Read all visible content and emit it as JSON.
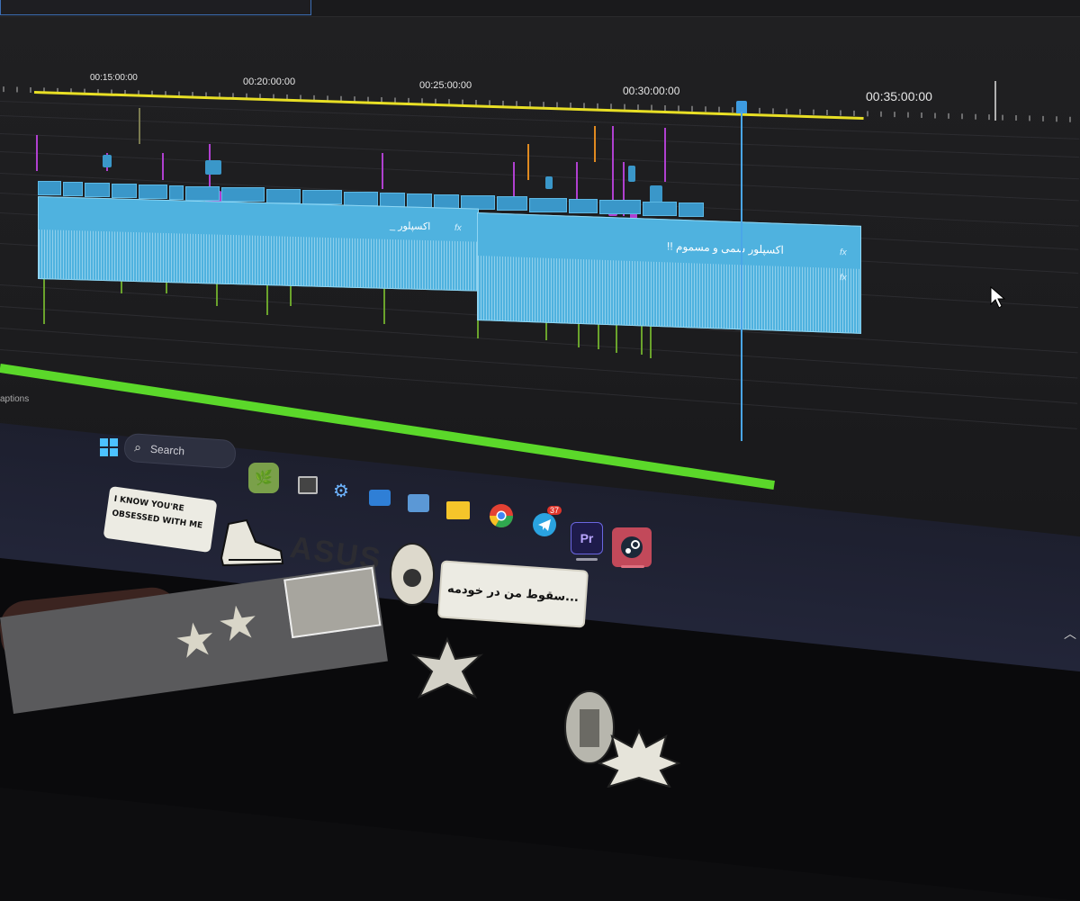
{
  "timeline": {
    "timecodes": [
      "00:15:00:00",
      "00:20:00:00",
      "00:25:00:00",
      "00:30:00:00",
      "00:35:00:00"
    ],
    "clip_title_1": "_ اکسپلور",
    "clip_title_2": "!! اکسپلور سمی و مسموم",
    "fx_label": "fx",
    "captions_label": "aptions"
  },
  "taskbar": {
    "search_placeholder": "Search",
    "telegram_badge": "37",
    "premiere_label": "Pr"
  },
  "colors": {
    "accent_clip": "#3a97c9",
    "audio_clip": "#4fb2df",
    "work_area": "#e8df25",
    "playhead": "#4aa6e8",
    "render_bar": "#5bd82a"
  },
  "stickers": {
    "sticker_1": "I KNOW YOU'RE OBSESSED WITH ME",
    "sticker_2": "سقوط من در خودمه...",
    "logo": "ASUS"
  }
}
